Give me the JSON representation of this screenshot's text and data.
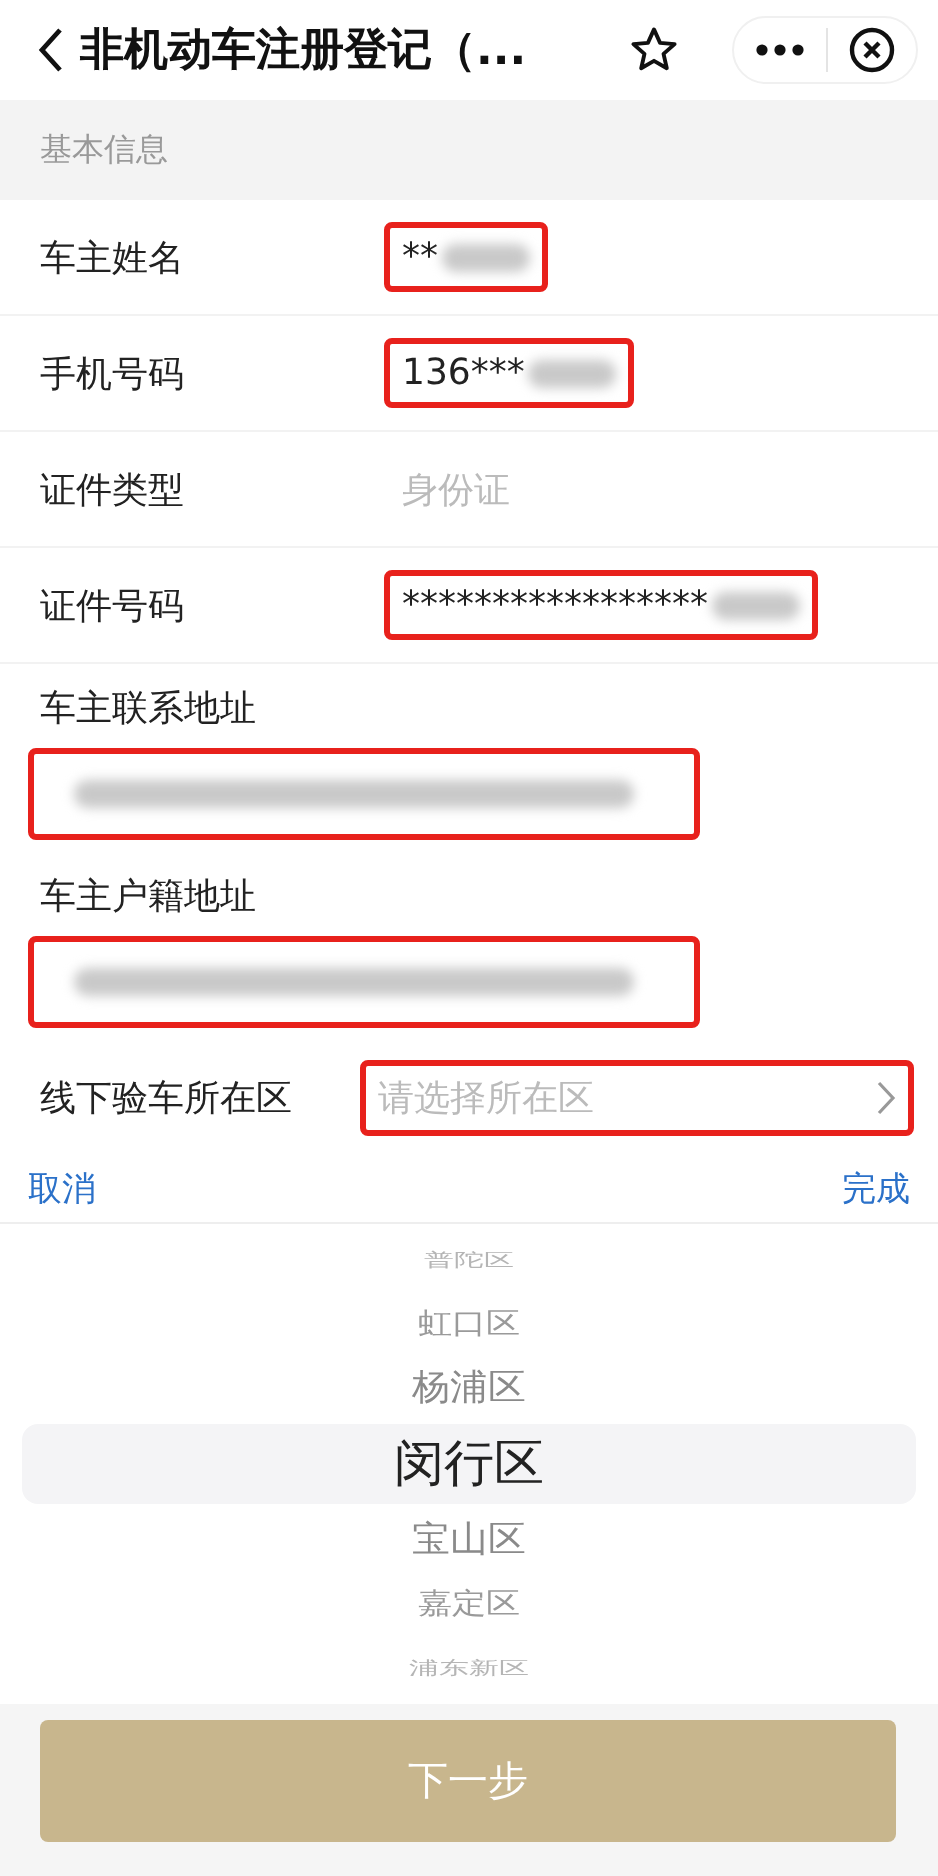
{
  "nav": {
    "title": "非机动车注册登记（..."
  },
  "section": {
    "title": "基本信息"
  },
  "fields": [
    {
      "kind": "inline",
      "label": "车主姓名",
      "value": "**",
      "redacted": true,
      "highlighted": true
    },
    {
      "kind": "inline",
      "label": "手机号码",
      "value": "136***",
      "redacted": true,
      "highlighted": true
    },
    {
      "kind": "inline",
      "label": "证件类型",
      "placeholder": "身份证",
      "highlighted": false
    },
    {
      "kind": "inline",
      "label": "证件号码",
      "value": "*****************",
      "redacted": true,
      "highlighted": true
    },
    {
      "kind": "stacked",
      "label": "车主联系地址",
      "redacted": true,
      "highlighted": true
    },
    {
      "kind": "stacked",
      "label": "车主户籍地址",
      "redacted": true,
      "highlighted": true
    },
    {
      "kind": "select",
      "label": "线下验车所在区",
      "placeholder": "请选择所在区",
      "highlighted": true
    }
  ],
  "picker": {
    "cancel": "取消",
    "done": "完成",
    "options": [
      {
        "label": "普陀区",
        "selected": false
      },
      {
        "label": "虹口区",
        "selected": false
      },
      {
        "label": "杨浦区",
        "selected": false
      },
      {
        "label": "闵行区",
        "selected": true
      },
      {
        "label": "宝山区",
        "selected": false
      },
      {
        "label": "嘉定区",
        "selected": false
      },
      {
        "label": "浦东新区",
        "selected": false
      }
    ]
  },
  "next_button": "下一步"
}
